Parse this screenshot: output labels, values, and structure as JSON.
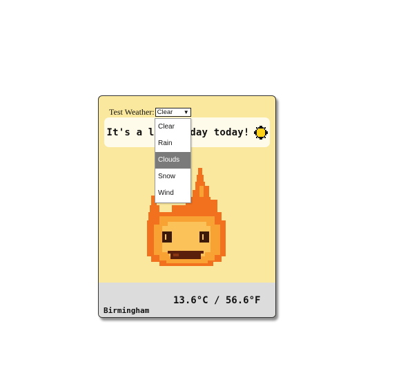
{
  "test_weather": {
    "label": "Test Weather:",
    "selected": "Clear",
    "options": [
      "Clear",
      "Rain",
      "Clouds",
      "Snow",
      "Wind"
    ],
    "highlighted": "Clouds"
  },
  "banner": {
    "message": "It's a lovely day today!",
    "icon": "sun-icon"
  },
  "character": {
    "icon": "fire-spirit-icon"
  },
  "footer": {
    "temperature": "13.6°C / 56.6°F",
    "city": "Birmingham"
  },
  "colors": {
    "card_bg": "#f9e89d",
    "banner_bg": "#fffbea",
    "footer_bg": "#dcdcdc",
    "highlight": "#7a7a7a"
  }
}
